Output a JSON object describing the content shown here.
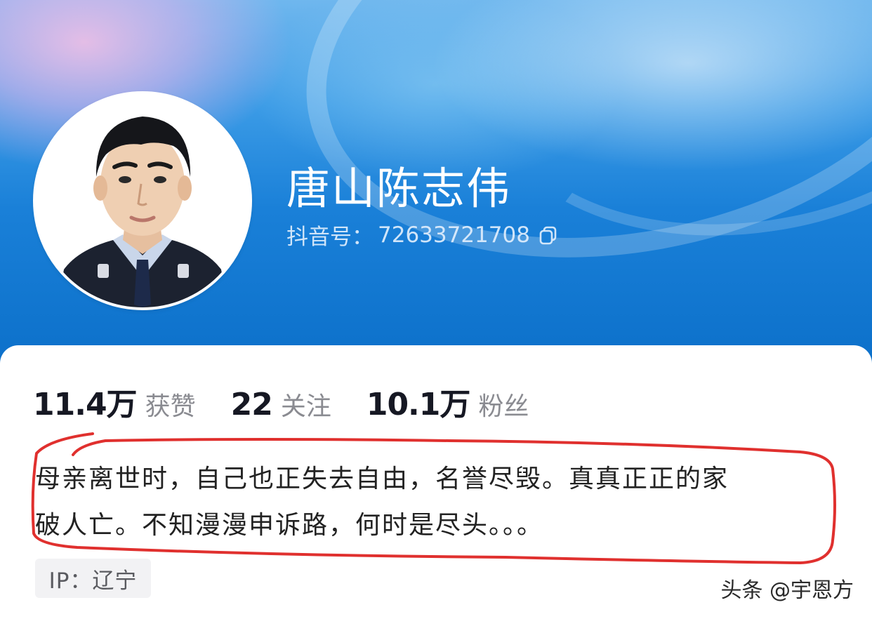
{
  "profile": {
    "display_name": "唐山陈志伟",
    "id_label": "抖音号：",
    "id_value": "72633721708",
    "avatar_icon": "avatar-photo-icon",
    "copy_icon": "copy-icon"
  },
  "stats": [
    {
      "value": "11.4万",
      "label": "获赞"
    },
    {
      "value": "22",
      "label": "关注"
    },
    {
      "value": "10.1万",
      "label": "粉丝"
    }
  ],
  "bio": {
    "line1": "母亲离世时，自己也正失去自由，名誉尽毁。真真正正的家",
    "line2": "破人亡。不知漫漫申诉路，何时是尽头。。。"
  },
  "ip": {
    "text": "IP：辽宁"
  },
  "watermark": {
    "text": "头条 @宇恩方"
  },
  "colors": {
    "header_blue": "#1a80d8",
    "annotation_red": "#e0302e",
    "stat_number": "#161823"
  }
}
